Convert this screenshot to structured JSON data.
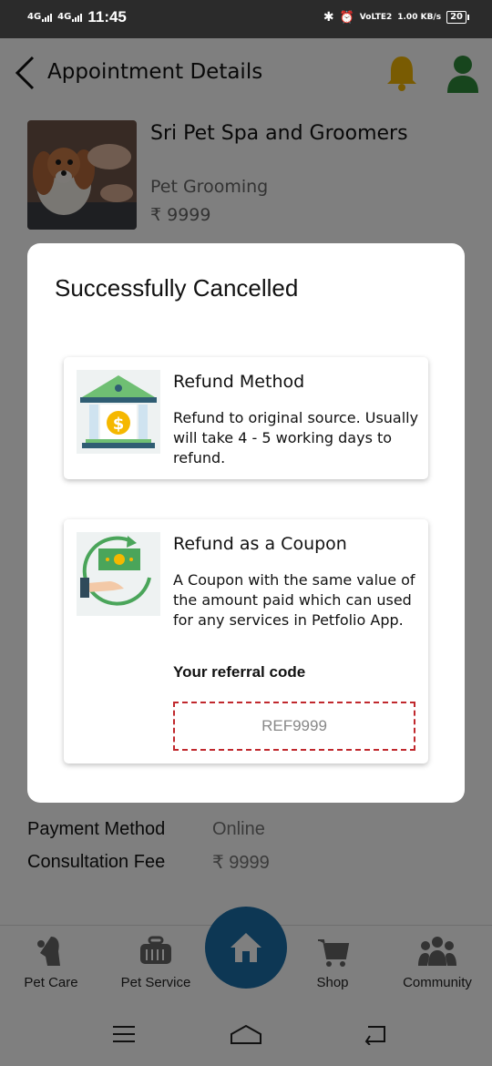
{
  "status_bar": {
    "net1": "4G",
    "net2": "4G",
    "time": "11:45",
    "volte": "VoLTE2",
    "speed": "1.00 KB/s",
    "battery": "20"
  },
  "header": {
    "title": "Appointment Details"
  },
  "service": {
    "shop_name": "Sri Pet Spa and Groomers",
    "type": "Pet Grooming",
    "price": "₹ 9999"
  },
  "details": [
    {
      "label": "Payment Method",
      "value": "Online"
    },
    {
      "label": "Consultation Fee",
      "value": "₹ 9999"
    }
  ],
  "bottom_nav": [
    {
      "label": "Pet Care",
      "icon": "pet-care-icon"
    },
    {
      "label": "Pet Service",
      "icon": "pet-carrier-icon"
    },
    {
      "label": "Shop",
      "icon": "cart-icon"
    },
    {
      "label": "Community",
      "icon": "community-icon"
    }
  ],
  "modal": {
    "title": "Successfully Cancelled",
    "refund": {
      "title": "Refund Method",
      "desc": "Refund to original source. Usually will take 4 - 5 working days to refund."
    },
    "coupon": {
      "title": "Refund as a Coupon",
      "desc": "A Coupon with the same value of the amount paid which can used for any services in Petfolio App.",
      "ref_label": "Your referral code",
      "ref_code": "REF9999"
    }
  },
  "colors": {
    "accent": "#1a6ea8",
    "bell": "#f2b705",
    "user": "#2e8b3a",
    "dashed": "#c0282d"
  }
}
